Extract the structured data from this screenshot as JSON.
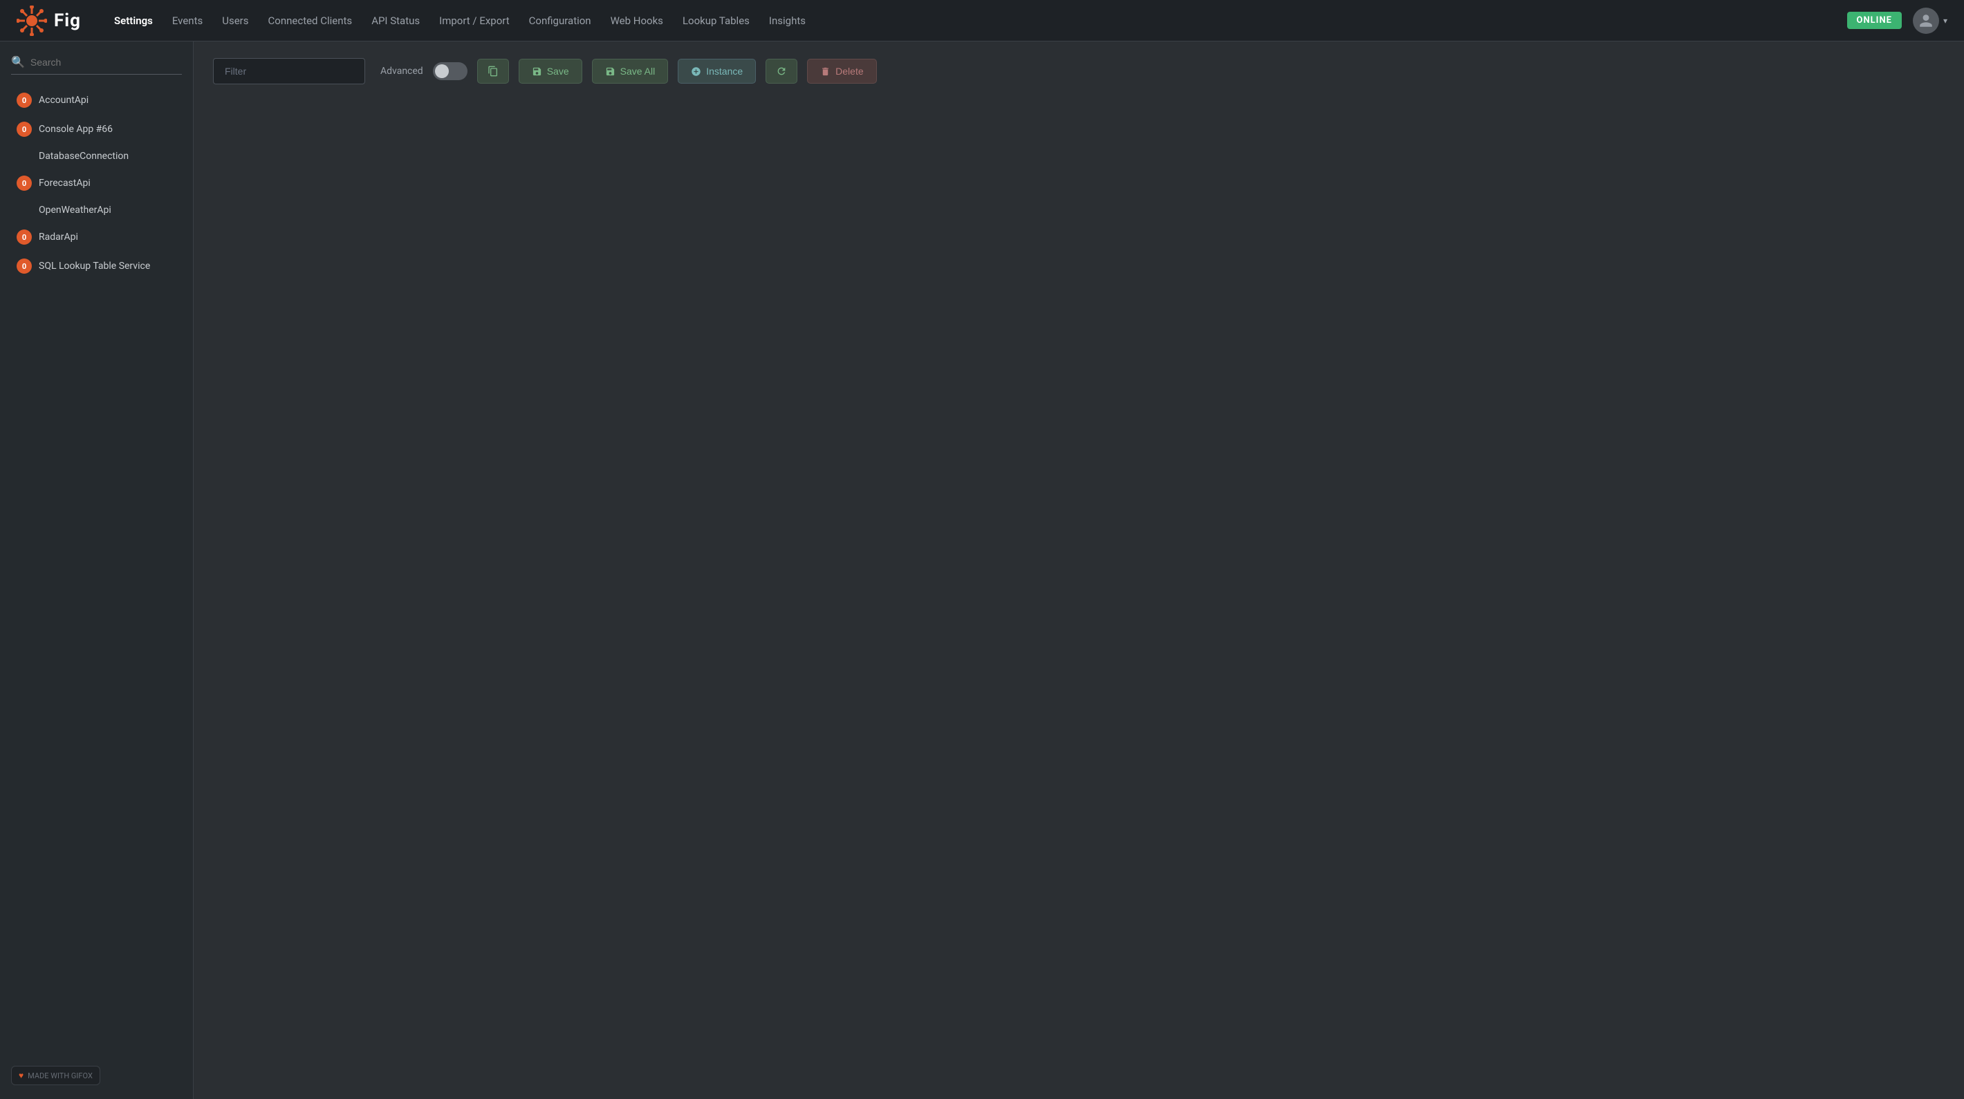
{
  "app": {
    "logo_text": "Fig",
    "status_badge": "ONLINE"
  },
  "navbar": {
    "links": [
      {
        "label": "Settings",
        "active": true
      },
      {
        "label": "Events",
        "active": false
      },
      {
        "label": "Users",
        "active": false
      },
      {
        "label": "Connected Clients",
        "active": false
      },
      {
        "label": "API Status",
        "active": false
      },
      {
        "label": "Import / Export",
        "active": false
      },
      {
        "label": "Configuration",
        "active": false
      },
      {
        "label": "Web Hooks",
        "active": false
      },
      {
        "label": "Lookup Tables",
        "active": false
      },
      {
        "label": "Insights",
        "active": false
      }
    ]
  },
  "sidebar": {
    "search_placeholder": "Search",
    "items": [
      {
        "label": "AccountApi",
        "badge": "0",
        "has_badge": true
      },
      {
        "label": "Console App #66",
        "badge": "0",
        "has_badge": true
      },
      {
        "label": "DatabaseConnection",
        "badge": null,
        "has_badge": false
      },
      {
        "label": "ForecastApi",
        "badge": "0",
        "has_badge": true
      },
      {
        "label": "OpenWeatherApi",
        "badge": null,
        "has_badge": false
      },
      {
        "label": "RadarApi",
        "badge": "0",
        "has_badge": true
      },
      {
        "label": "SQL Lookup Table Service",
        "badge": "0",
        "has_badge": true
      }
    ],
    "made_with_label": "MADE WITH GIFOX"
  },
  "toolbar": {
    "filter_placeholder": "Filter",
    "advanced_label": "Advanced",
    "save_label": "Save",
    "save_all_label": "Save All",
    "instance_label": "Instance",
    "delete_label": "Delete"
  }
}
